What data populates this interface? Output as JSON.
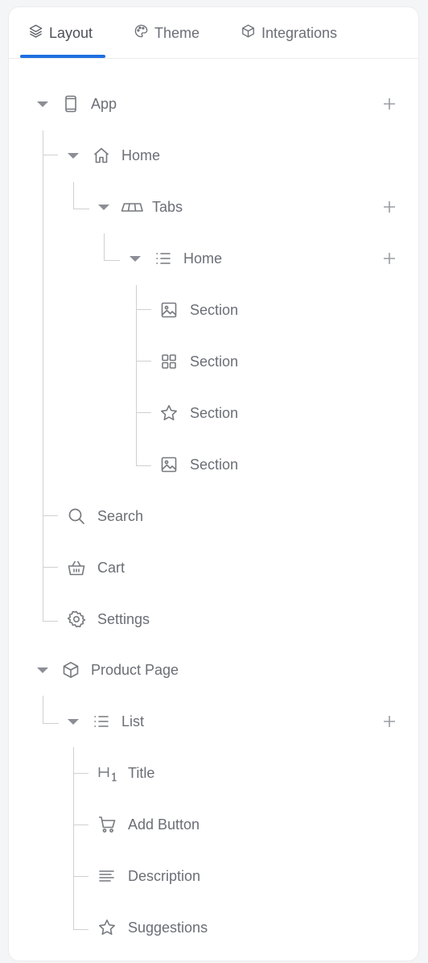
{
  "tabs": [
    {
      "label": "Layout",
      "icon": "layers-icon",
      "active": true
    },
    {
      "label": "Theme",
      "icon": "palette-icon",
      "active": false
    },
    {
      "label": "Integrations",
      "icon": "cube-icon",
      "active": false
    }
  ],
  "accent_color": "#1f6fe0",
  "tree": {
    "app": "App",
    "home": "Home",
    "tabs": "Tabs",
    "home_list": "Home",
    "section_1": "Section",
    "section_2": "Section",
    "section_3": "Section",
    "section_4": "Section",
    "search": "Search",
    "cart": "Cart",
    "settings": "Settings",
    "product_page": "Product Page",
    "list": "List",
    "title": "Title",
    "add_button": "Add Button",
    "description": "Description",
    "suggestions": "Suggestions"
  }
}
